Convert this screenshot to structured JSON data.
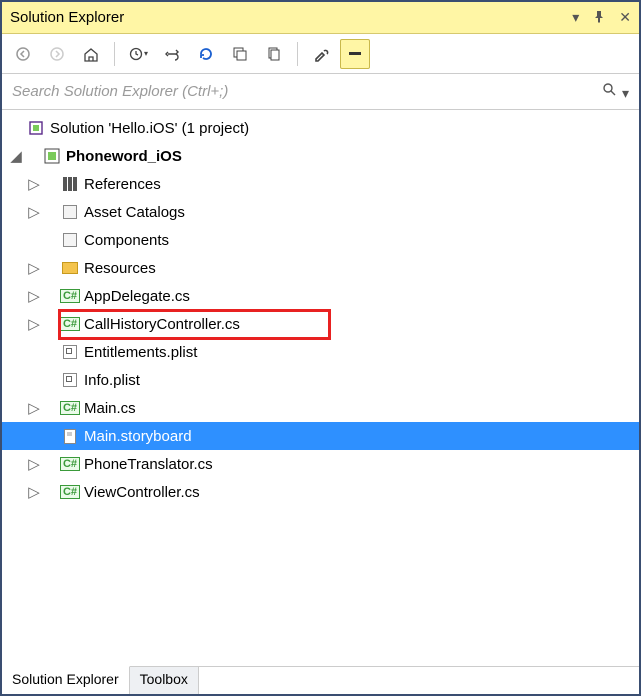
{
  "titlebar": {
    "title": "Solution Explorer"
  },
  "search": {
    "placeholder": "Search Solution Explorer (Ctrl+;)"
  },
  "tree": {
    "solution_label": "Solution 'Hello.iOS' (1 project)",
    "project_label": "Phoneword_iOS",
    "references_label": "References",
    "asset_catalogs_label": "Asset Catalogs",
    "components_label": "Components",
    "resources_label": "Resources",
    "appdelegate_label": "AppDelegate.cs",
    "callhistory_label": "CallHistoryController.cs",
    "entitlements_label": "Entitlements.plist",
    "infoplist_label": "Info.plist",
    "main_cs_label": "Main.cs",
    "main_sb_label": "Main.storyboard",
    "phonetrans_label": "PhoneTranslator.cs",
    "viewctrl_label": "ViewController.cs"
  },
  "tabs": {
    "solution_explorer": "Solution Explorer",
    "toolbox": "Toolbox"
  }
}
